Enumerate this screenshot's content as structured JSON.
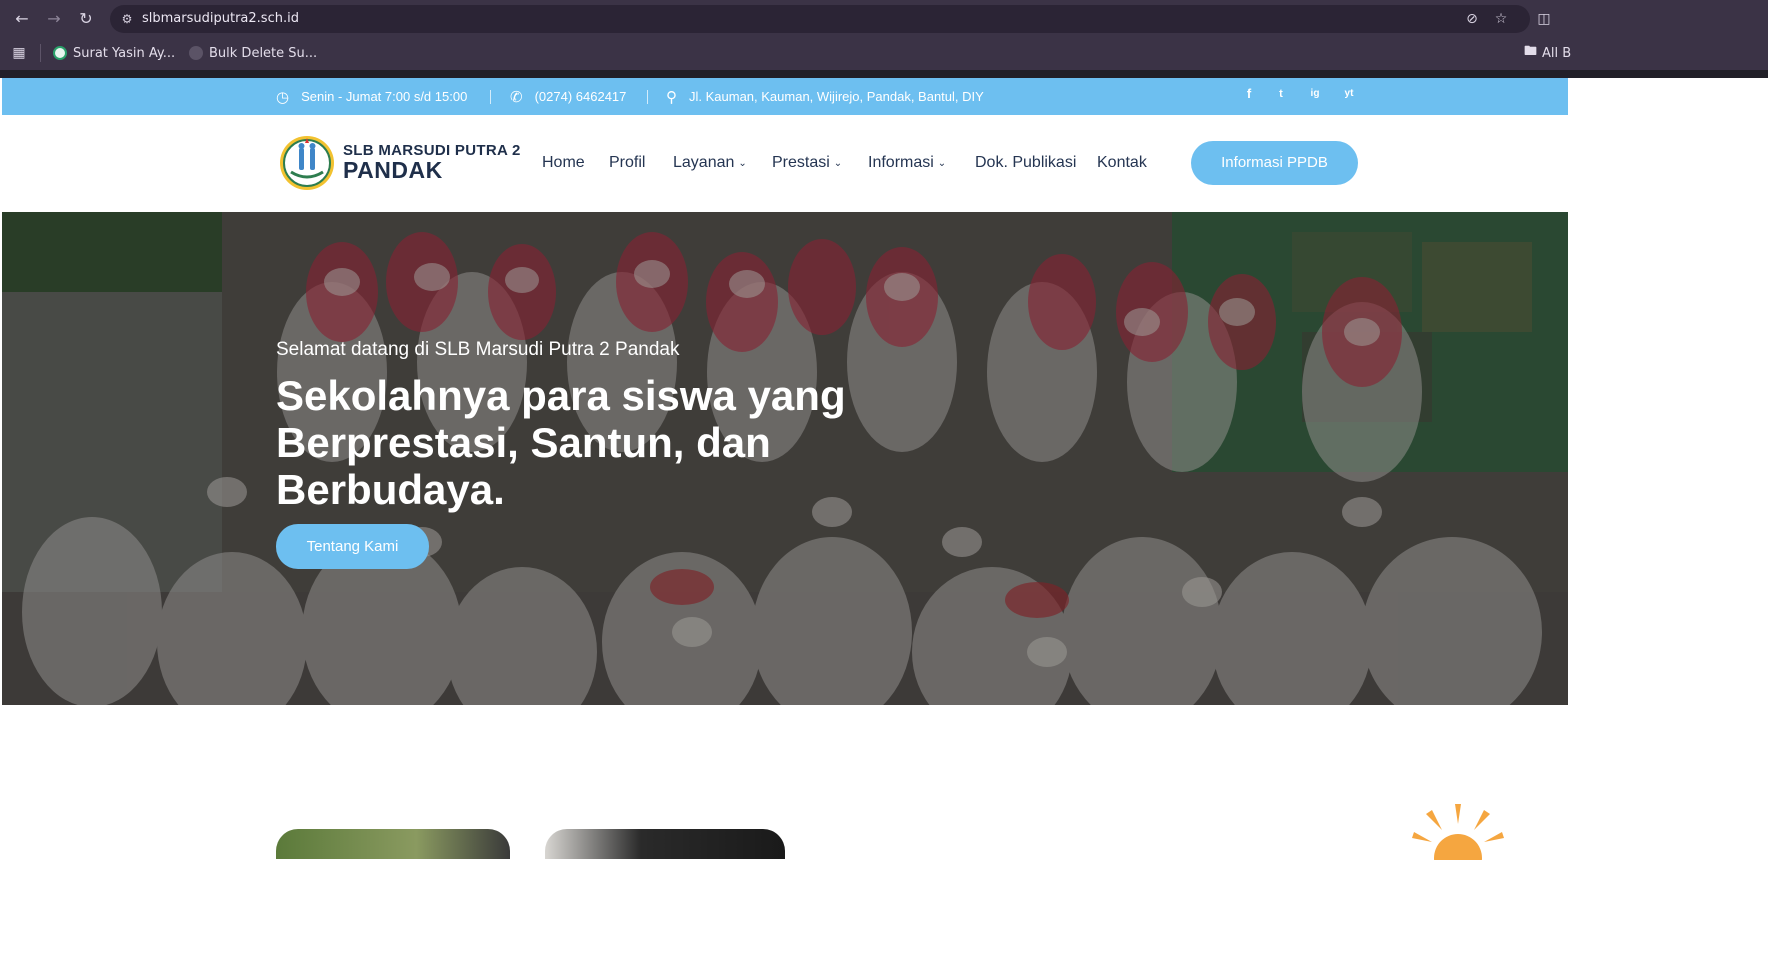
{
  "browser": {
    "url": "slbmarsudiputra2.sch.id",
    "bookmarks": [
      {
        "label": "Surat Yasin Ay..."
      },
      {
        "label": "Bulk Delete Su..."
      }
    ],
    "all_bookmarks_label": "All B"
  },
  "topbar": {
    "hours": "Senin - Jumat 7:00 s/d 15:00",
    "phone": "(0274) 6462417",
    "address": "Jl. Kauman, Kauman, Wijirejo, Pandak, Bantul, DIY",
    "social": [
      "f",
      "t",
      "ig",
      "yt"
    ]
  },
  "logo": {
    "line1": "SLB MARSUDI PUTRA 2",
    "line2": "PANDAK"
  },
  "menu": {
    "home": "Home",
    "profil": "Profil",
    "layanan": "Layanan",
    "prestasi": "Prestasi",
    "informasi": "Informasi",
    "publikasi": "Dok. Publikasi",
    "kontak": "Kontak",
    "ppdb": "Informasi PPDB"
  },
  "hero": {
    "subtitle": "Selamat datang di SLB Marsudi Putra 2 Pandak",
    "title": "Sekolahnya para siswa yang Berprestasi, Santun, dan Berbudaya.",
    "button": "Tentang Kami"
  },
  "colors": {
    "accent": "#6dbff0",
    "nav_text": "#253552",
    "chrome": "#3b3346"
  }
}
